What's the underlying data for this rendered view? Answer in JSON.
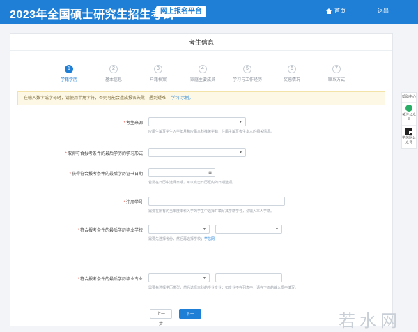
{
  "header": {
    "title": "2023年全国硕士研究生招生考试",
    "badge": "网上报名平台",
    "home_label": "首页",
    "exit_label": "退出",
    "bg_color": "#1f7fd6"
  },
  "card": {
    "title": "考生信息"
  },
  "steps": [
    {
      "num": "1",
      "label": "学籍学历"
    },
    {
      "num": "2",
      "label": "基本信息"
    },
    {
      "num": "3",
      "label": "户籍档案"
    },
    {
      "num": "4",
      "label": "家庭主要成员"
    },
    {
      "num": "5",
      "label": "学习与工作经历"
    },
    {
      "num": "6",
      "label": "奖惩情况"
    },
    {
      "num": "7",
      "label": "联系方式"
    }
  ],
  "notice": {
    "text": "在输入数字或字母时，请使用半角字符，否则可能会造成报名失败；遇到疑难：",
    "link": "学习 示例。"
  },
  "form": {
    "f1_label": "考生来源：",
    "f1_help": "应届生填写学生入学年月和应届本科推免学籍，往届生填写考生本人的相关情况。",
    "f2_label": "取得符合报考条件的最后学历的学习形式：",
    "f3_label": "获得符合报考条件的最后学历证书日期：",
    "f3_help": "若需在日历中选择日期，可以点击日历框内的日期选项。",
    "f4_label": "注册学号：",
    "f4_help": "需要在所有的当年度本科入学的学生中选择并填写其学籍学号，请输入本人学籍。",
    "f5_label": "符合报考条件的最后学历毕业学校：",
    "f5_help": "需要先选择省份，然后再选择学校；",
    "f5_link": "学信网",
    "f6_label": "符合报考条件的最后学历毕业专业：",
    "f6_help": "需要先选择学历类型，然后选择本科的毕业专业；如专业不在列表中，请在下面的输入框中填写。"
  },
  "buttons": {
    "prev": "上一步",
    "next": "下一步"
  },
  "float_bar": {
    "help": "帮助中心",
    "wechat": "关注公众号",
    "qr": "学信网公众号"
  },
  "watermark": "若水网"
}
